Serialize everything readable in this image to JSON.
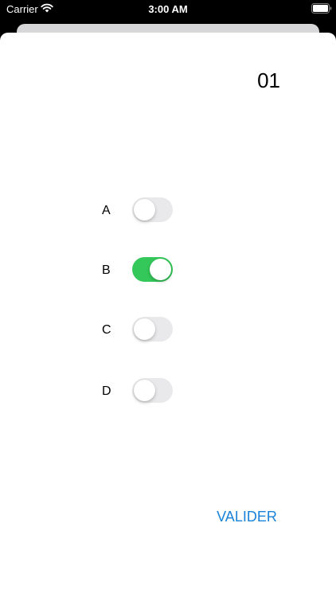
{
  "status_bar": {
    "carrier": "Carrier",
    "time": "3:00 AM",
    "icons": [
      "wifi-icon",
      "battery-icon"
    ]
  },
  "question": {
    "number": "01"
  },
  "options": [
    {
      "label": "A",
      "on": false
    },
    {
      "label": "B",
      "on": true
    },
    {
      "label": "C",
      "on": false
    },
    {
      "label": "D",
      "on": false
    }
  ],
  "actions": {
    "submit_label": "VALIDER"
  },
  "colors": {
    "switch_on": "#34c759",
    "switch_off": "#e9e9eb",
    "accent": "#1a82d8",
    "background": "#ffffff"
  }
}
